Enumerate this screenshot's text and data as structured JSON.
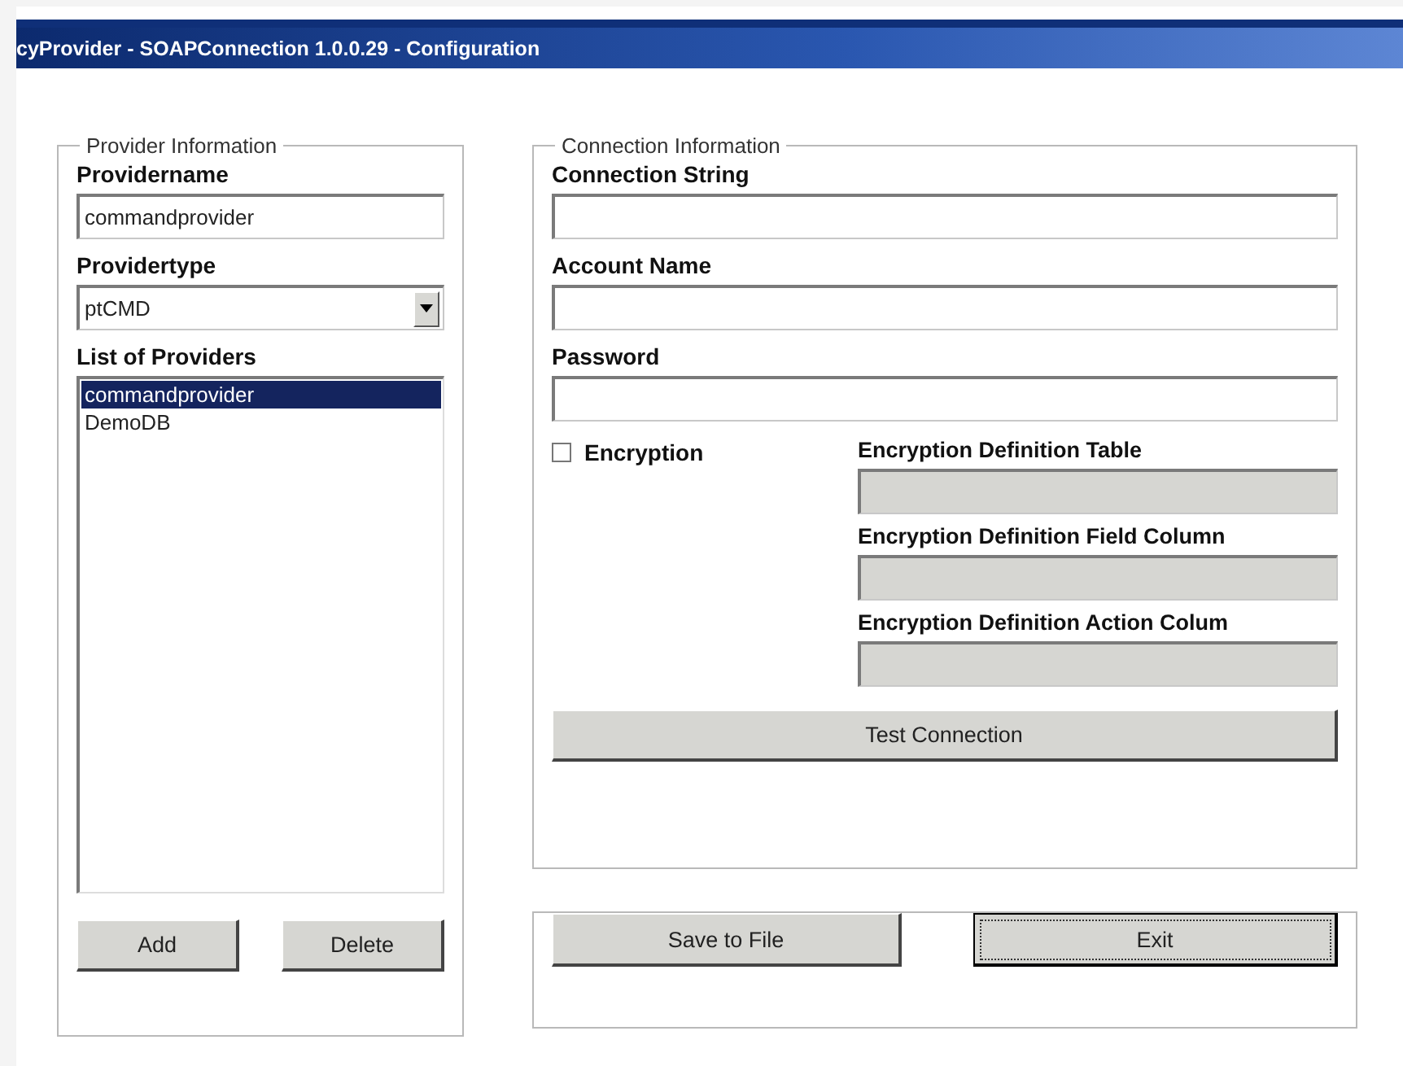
{
  "window": {
    "title": "cyProvider - SOAPConnection 1.0.0.29 - Configuration"
  },
  "provider_information": {
    "title": "Provider Information",
    "providername": {
      "label": "Providername",
      "value": "commandprovider"
    },
    "providertype": {
      "label": "Providertype",
      "value": "ptCMD"
    },
    "list_of_providers": {
      "label": "List of Providers",
      "items": [
        {
          "label": "commandprovider",
          "selected": true
        },
        {
          "label": "DemoDB",
          "selected": false
        }
      ]
    },
    "buttons": [
      "Add",
      "Delete"
    ]
  },
  "connection_information": {
    "title": "Connection Information",
    "fields": [
      {
        "label": "Connection String"
      },
      {
        "label": "Account Name"
      },
      {
        "label": "Password"
      }
    ],
    "encryption": {
      "label": "Encryption",
      "checked": false
    },
    "encryption_fields": [
      {
        "label": "Encryption Definition Table",
        "disabled": true
      },
      {
        "label": "Encryption Definition Field Column",
        "disabled": true
      },
      {
        "label": "Encryption Definition Action Colum",
        "disabled": true
      }
    ],
    "test_button": "Test Connection"
  },
  "footer": {
    "buttons": [
      {
        "label": "Save to File",
        "focused": false
      },
      {
        "label": "Exit",
        "focused": true
      }
    ]
  }
}
